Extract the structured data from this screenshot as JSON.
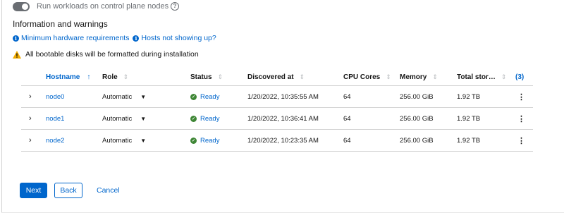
{
  "toggle": {
    "label": "Run workloads on control plane nodes",
    "enabled": true
  },
  "info_section": {
    "title": "Information and warnings",
    "links": [
      "Minimum hardware requirements",
      "Hosts not showing up?"
    ],
    "warning": "All bootable disks will be formatted during installation"
  },
  "table": {
    "columns": [
      "Hostname",
      "Role",
      "Status",
      "Discovered at",
      "CPU Cores",
      "Memory",
      "Total stor…",
      "(3)"
    ],
    "sorted_column": "Hostname",
    "rows": [
      {
        "hostname": "node0",
        "role": "Automatic",
        "status": "Ready",
        "discovered": "1/20/2022, 10:35:55 AM",
        "cpu": "64",
        "memory": "256.00 GiB",
        "storage": "1.92 TB"
      },
      {
        "hostname": "node1",
        "role": "Automatic",
        "status": "Ready",
        "discovered": "1/20/2022, 10:36:41 AM",
        "cpu": "64",
        "memory": "256.00 GiB",
        "storage": "1.92 TB"
      },
      {
        "hostname": "node2",
        "role": "Automatic",
        "status": "Ready",
        "discovered": "1/20/2022, 10:23:35 AM",
        "cpu": "64",
        "memory": "256.00 GiB",
        "storage": "1.92 TB"
      }
    ]
  },
  "footer": {
    "next": "Next",
    "back": "Back",
    "cancel": "Cancel"
  },
  "colors": {
    "link": "#0066cc",
    "success": "#3e8635",
    "warning": "#f0ab00",
    "primary": "#0066cc"
  },
  "icons": [
    "question-circle-icon",
    "info-circle-icon",
    "warning-triangle-icon",
    "sort-icon",
    "chevron-right-icon",
    "caret-down-icon",
    "check-circle-icon",
    "kebab-icon"
  ]
}
